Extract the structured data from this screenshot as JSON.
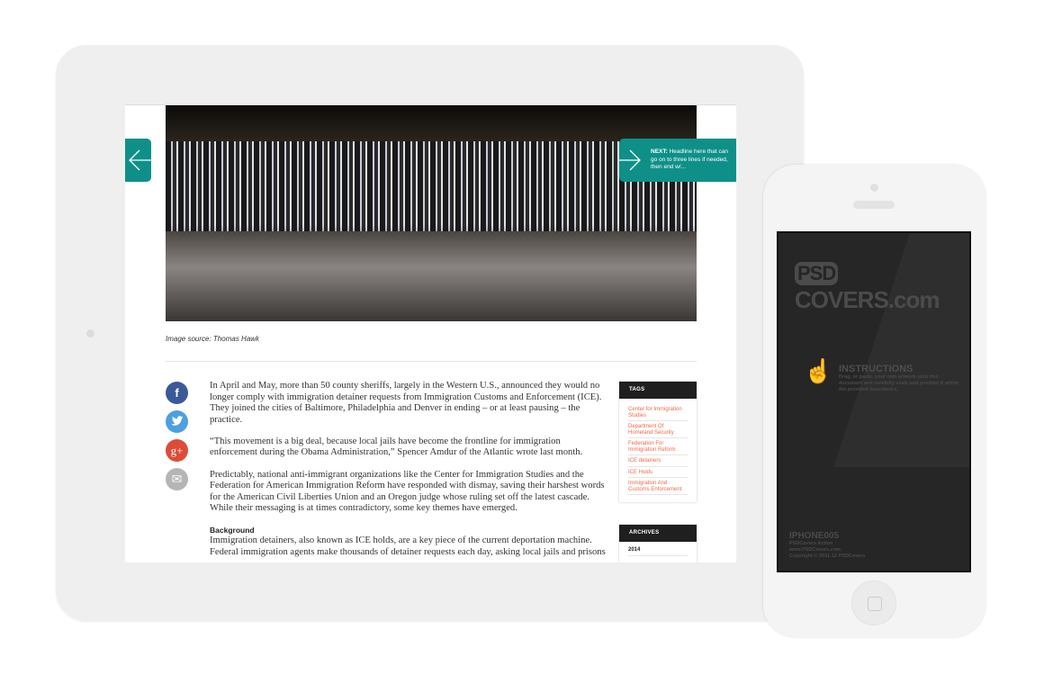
{
  "article": {
    "image_caption": "Image source: Thomas Hawk",
    "next": {
      "label": "NEXT:",
      "headline": "Headline here that can go on to three lines if needed, then end w/..."
    },
    "paragraphs": [
      [
        "In April and May, more than 50 county sheriffs, largely in the Western U.S., announced they would no",
        "longer comply with immigration detainer requests from Immigration Customs and Enforcement (ICE).",
        "They joined the cities of Baltimore, Philadelphia and Denver in ending – or at least pausing – the",
        "practice."
      ],
      [
        "“This movement is a big deal, because local jails have become the frontline for immigration",
        "enforcement during the Obama Administration,” Spencer Amdur of the Atlantic wrote last month."
      ],
      [
        "Predictably, national anti-immigrant organizations like the Center for Immigration Studies and the",
        "Federation for American Immigration Reform have responded with dismay, saving their harshest words",
        "for the American Civil Liberties Union and an Oregon judge whose ruling set off the latest cascade.",
        "While their messaging is at times contradictory, some key themes have emerged."
      ]
    ],
    "subheading": "Background",
    "background": [
      "Immigration detainers, also known as ICE holds, are a key piece of the current deportation machine.",
      "Federal immigration agents make thousands of detainer requests each day, asking local jails and prisons"
    ]
  },
  "share": {
    "facebook": "f",
    "google": "g+",
    "email": "✉"
  },
  "tags": {
    "title": "TAGS",
    "items": [
      "Center for Immigration Studies",
      "Department Of Homeland Security",
      "Federation For Immigration Reform",
      "ICE detainers",
      "ICE Holds",
      "Immigration And Customs Enforcement"
    ]
  },
  "archives": {
    "title": "ARCHIVES",
    "items": [
      "2014"
    ]
  },
  "phone": {
    "logo_psd": "PSD",
    "logo_rest": "COVERS.com",
    "instructions_title": "INSTRUCTIONS",
    "instructions_text": "Drag, or paste, your own artwork onto this document and carefully scale and position it within the provided boundaries.",
    "model": "IPHONE005",
    "line1": "PSDCovers Action",
    "line2": "www.PSDCovers.com",
    "line3": "Copyright © 2011-12 PSDCovers"
  },
  "colors": {
    "accent": "#0e9089",
    "tag": "#ee6a47"
  }
}
